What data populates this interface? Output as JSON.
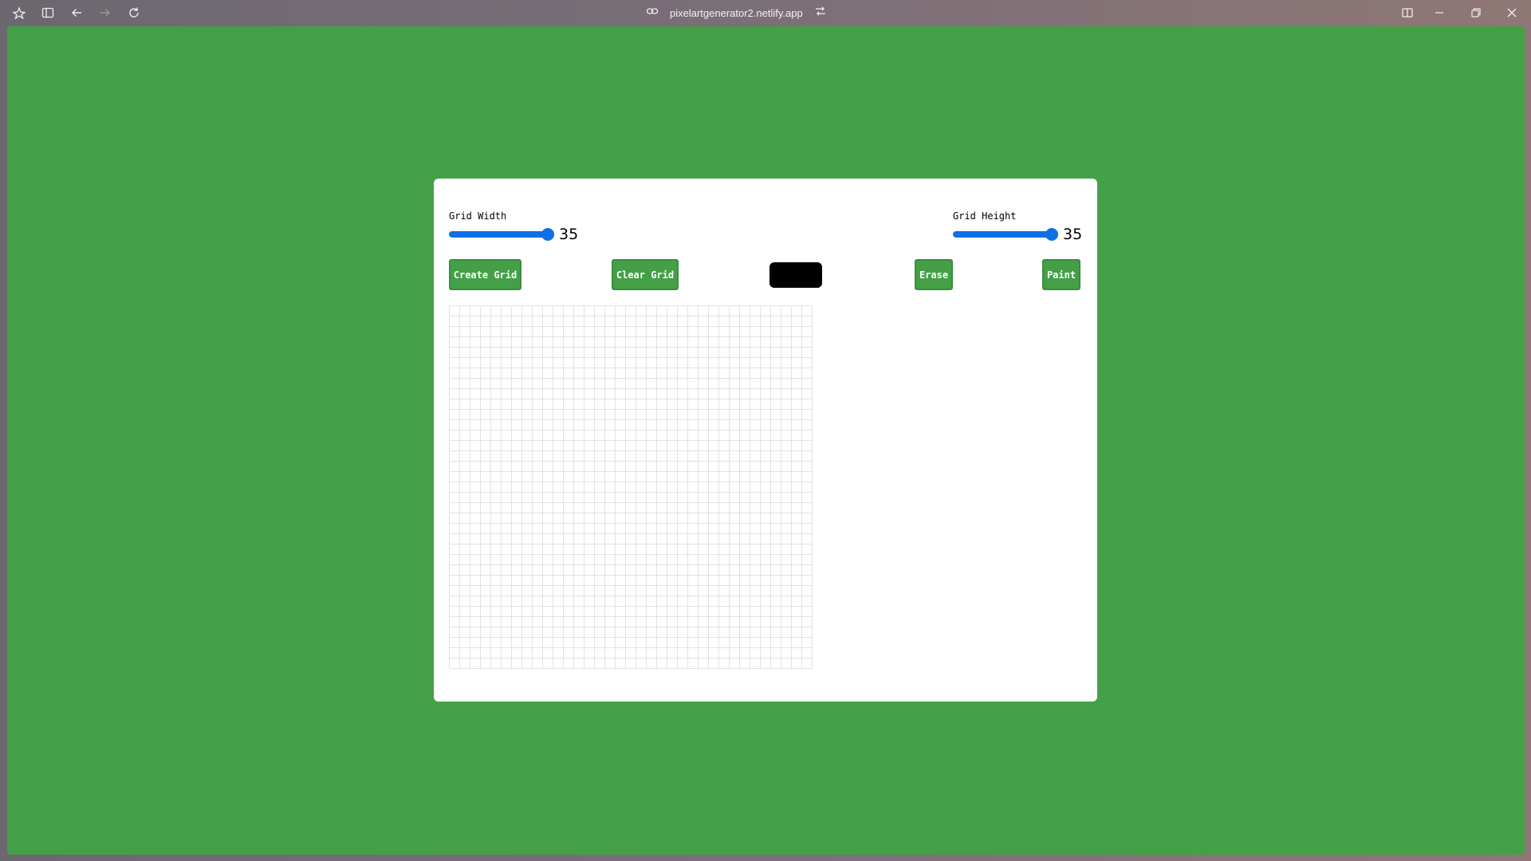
{
  "browser": {
    "url": "pixelartgenerator2.netlify.app",
    "icons": [
      "app-menu-icon",
      "sidebar-toggle-icon",
      "back-icon",
      "forward-icon",
      "reload-icon",
      "link-icon",
      "site-settings-icon",
      "split-view-icon",
      "minimize-icon",
      "restore-icon",
      "close-icon"
    ]
  },
  "page": {
    "background_color": "#43a047",
    "width_control": {
      "label": "Grid Width",
      "value": "35"
    },
    "height_control": {
      "label": "Grid Height",
      "value": "35"
    },
    "buttons": {
      "create": "Create Grid",
      "clear": "Clear Grid",
      "erase": "Erase",
      "paint": "Paint"
    },
    "selected_color": "#000000",
    "grid": {
      "columns": 35,
      "rows": 35
    }
  }
}
